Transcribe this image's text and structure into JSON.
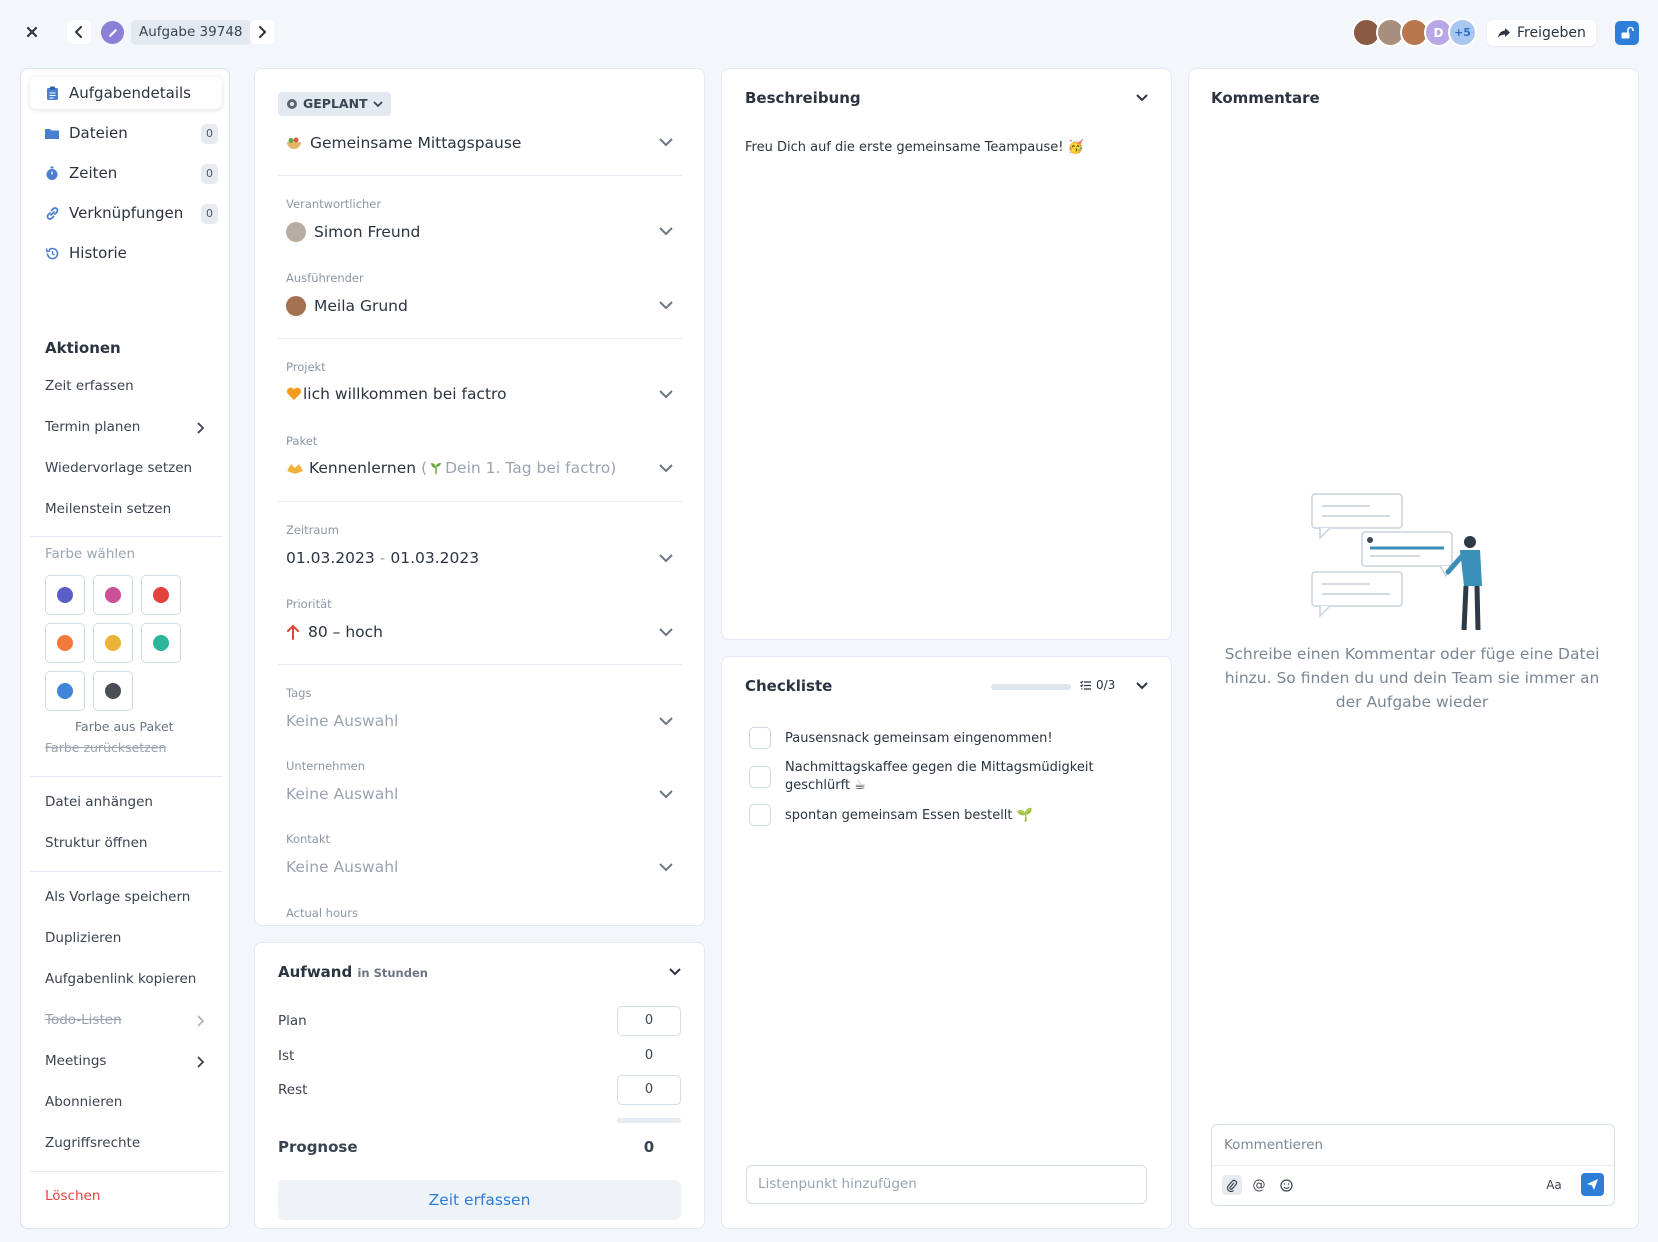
{
  "topbar": {
    "task_number": "Aufgabe 39748",
    "extra_avatars": "+5",
    "avatar_letter": "D",
    "share_label": "Freigeben"
  },
  "sidebar": {
    "nav": [
      {
        "label": "Aufgabendetails"
      },
      {
        "label": "Dateien",
        "count": "0"
      },
      {
        "label": "Zeiten",
        "count": "0"
      },
      {
        "label": "Verknüpfungen",
        "count": "0"
      },
      {
        "label": "Historie"
      }
    ],
    "actions_title": "Aktionen",
    "actions": {
      "log_time": "Zeit erfassen",
      "schedule": "Termin planen",
      "resubmission": "Wiedervorlage setzen",
      "milestone": "Meilenstein setzen",
      "choose_color": "Farbe wählen",
      "color_from_package": "Farbe aus Paket",
      "reset_color": "Farbe zurücksetzen",
      "attach_file": "Datei anhängen",
      "open_structure": "Struktur öffnen",
      "save_template": "Als Vorlage speichern",
      "duplicate": "Duplizieren",
      "copy_link": "Aufgabenlink kopieren",
      "todo_lists": "Todo-Listen",
      "meetings": "Meetings",
      "subscribe": "Abonnieren",
      "permissions": "Zugriffsrechte",
      "delete": "Löschen"
    },
    "colors": [
      "#5a5fc7",
      "#cc4f98",
      "#e0443a",
      "#f37a3a",
      "#ecb23a",
      "#2bb59a",
      "#3f86d8",
      "#4a4f57"
    ]
  },
  "details": {
    "status": "GEPLANT",
    "title": "Gemeinsame Mittagspause",
    "responsible_label": "Verantwortlicher",
    "responsible": "Simon Freund",
    "executor_label": "Ausführender",
    "executor": "Meila Grund",
    "project_label": "Projekt",
    "project": "lich willkommen bei factro",
    "package_label": "Paket",
    "package": "Kennenlernen",
    "package_parent": "Dein 1. Tag bei factro)",
    "period_label": "Zeitraum",
    "period_start": "01.03.2023",
    "period_sep": "-",
    "period_end": "01.03.2023",
    "priority_label": "Priorität",
    "priority": "80 – hoch",
    "tags_label": "Tags",
    "tags": "Keine Auswahl",
    "company_label": "Unternehmen",
    "company": "Keine Auswahl",
    "contact_label": "Kontakt",
    "contact": "Keine Auswahl",
    "actual_hours_label": "Actual hours"
  },
  "effort": {
    "title": "Aufwand",
    "unit": "in Stunden",
    "plan_label": "Plan",
    "plan": "0",
    "actual_label": "Ist",
    "actual": "0",
    "rest_label": "Rest",
    "rest": "0",
    "forecast_label": "Prognose",
    "forecast": "0",
    "button": "Zeit erfassen"
  },
  "description": {
    "title": "Beschreibung",
    "text": "Freu Dich auf die erste gemeinsame Teampause! 🥳"
  },
  "checklist": {
    "title": "Checkliste",
    "count": "0/3",
    "progress": 0,
    "items": [
      {
        "text": "Pausensnack gemeinsam eingenommen!"
      },
      {
        "text": "Nachmittagskaffee gegen die Mittagsmüdigkeit geschlürft ☕"
      },
      {
        "text": "spontan gemeinsam Essen bestellt 🌱"
      }
    ],
    "add_placeholder": "Listenpunkt hinzufügen"
  },
  "comments": {
    "title": "Kommentare",
    "empty_text": "Schreibe einen Kommentar oder füge eine Datei hinzu. So finden du und dein Team sie immer an der Aufgabe wieder",
    "placeholder": "Kommentieren",
    "format_label": "Aa",
    "mention": "@"
  }
}
